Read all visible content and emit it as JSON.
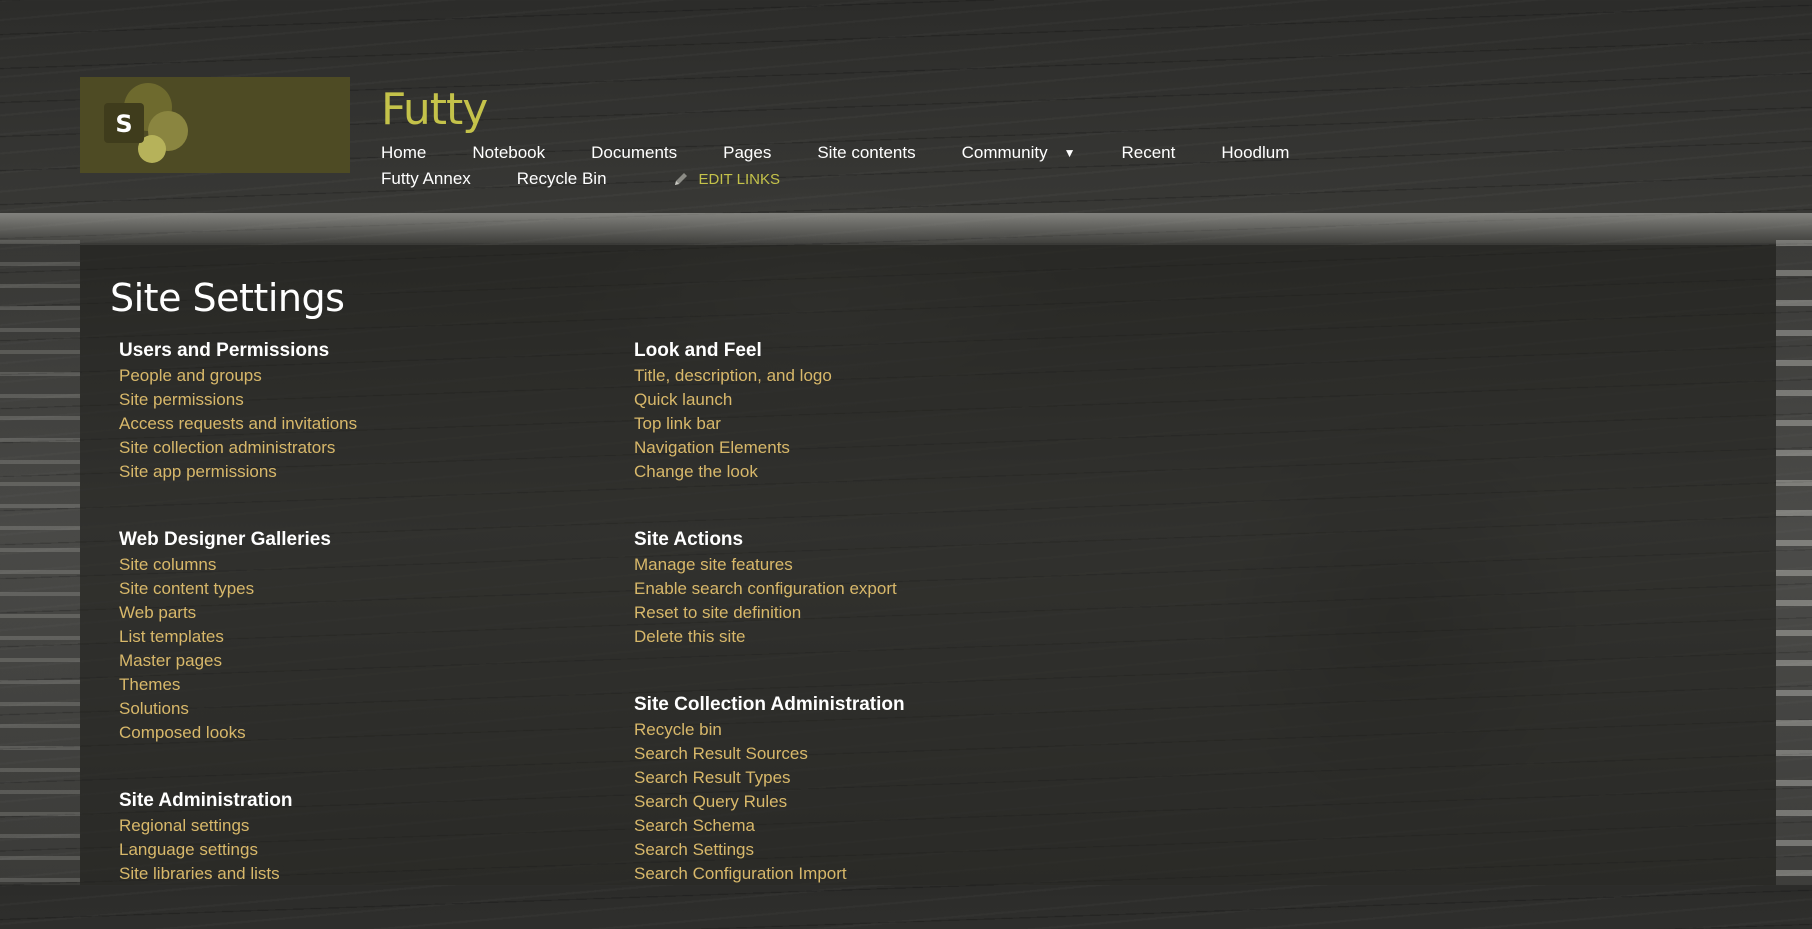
{
  "site": {
    "title": "Futty",
    "logo_letter": "S"
  },
  "topnav": {
    "row1": [
      "Home",
      "Notebook",
      "Documents",
      "Pages",
      "Site contents",
      "Community",
      "Recent",
      "Hoodlum"
    ],
    "row2": [
      "Futty Annex",
      "Recycle Bin"
    ],
    "edit_links": "EDIT LINKS"
  },
  "page": {
    "title": "Site Settings"
  },
  "sections": {
    "users": {
      "heading": "Users and Permissions",
      "links": [
        "People and groups",
        "Site permissions",
        "Access requests and invitations",
        "Site collection administrators",
        "Site app permissions"
      ]
    },
    "galleries": {
      "heading": "Web Designer Galleries",
      "links": [
        "Site columns",
        "Site content types",
        "Web parts",
        "List templates",
        "Master pages",
        "Themes",
        "Solutions",
        "Composed looks"
      ]
    },
    "site_admin": {
      "heading": "Site Administration",
      "links": [
        "Regional settings",
        "Language settings",
        "Site libraries and lists"
      ]
    },
    "look": {
      "heading": "Look and Feel",
      "links": [
        "Title, description, and logo",
        "Quick launch",
        "Top link bar",
        "Navigation Elements",
        "Change the look"
      ]
    },
    "actions": {
      "heading": "Site Actions",
      "links": [
        "Manage site features",
        "Enable search configuration export",
        "Reset to site definition",
        "Delete this site"
      ]
    },
    "collection": {
      "heading": "Site Collection Administration",
      "links": [
        "Recycle bin",
        "Search Result Sources",
        "Search Result Types",
        "Search Query Rules",
        "Search Schema",
        "Search Settings",
        "Search Configuration Import"
      ]
    }
  },
  "colors": {
    "accent_title": "#c4c24a",
    "link": "#d8b86a",
    "logo_bg": "#4e4b24"
  },
  "icons": {
    "logo": "sharepoint-logo-icon",
    "caret": "chevron-down-icon",
    "edit": "pencil-icon"
  }
}
